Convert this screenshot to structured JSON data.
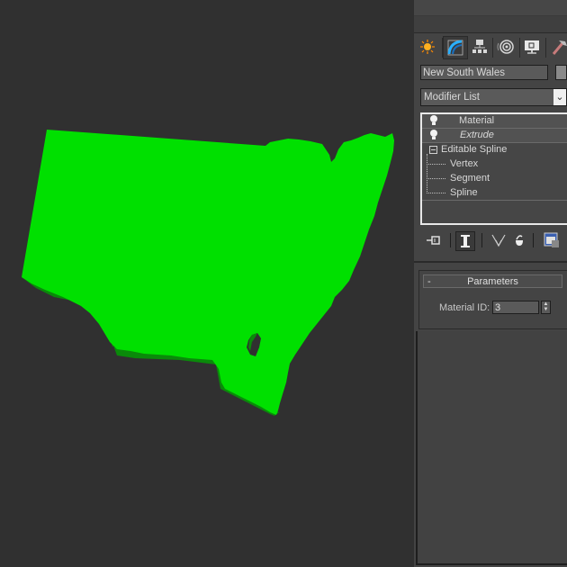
{
  "viewport": {
    "object_name": "New South Wales",
    "object_color": "#00e000",
    "background_color": "#303030"
  },
  "command_panel": {
    "tabs": [
      {
        "name": "create",
        "icon": "create-icon"
      },
      {
        "name": "modify",
        "icon": "modify-icon",
        "active": true
      },
      {
        "name": "hierarchy",
        "icon": "hierarchy-icon"
      },
      {
        "name": "motion",
        "icon": "motion-icon"
      },
      {
        "name": "display",
        "icon": "display-icon"
      },
      {
        "name": "utilities",
        "icon": "utilities-icon"
      }
    ],
    "object_name_value": "New South Wales",
    "modifier_list_label": "Modifier List",
    "modifier_list_arrow": "⌄",
    "stack": {
      "items": [
        {
          "label": "Material",
          "type": "modifier"
        },
        {
          "label": "Extrude",
          "type": "modifier",
          "italic": true
        },
        {
          "label": "Editable Spline",
          "type": "base"
        },
        {
          "label": "Vertex",
          "type": "sub"
        },
        {
          "label": "Segment",
          "type": "sub"
        },
        {
          "label": "Spline",
          "type": "sub"
        }
      ]
    },
    "stack_tools": [
      {
        "name": "pin-stack",
        "icon": "pin-icon"
      },
      {
        "name": "show-end-result",
        "icon": "end-result-icon",
        "active": true
      },
      {
        "name": "make-unique",
        "icon": "make-unique-icon"
      },
      {
        "name": "remove-modifier",
        "icon": "remove-modifier-icon"
      },
      {
        "name": "configure-modifier-sets",
        "icon": "configure-icon"
      }
    ],
    "parameters": {
      "title": "Parameters",
      "collapse_symbol": "-",
      "material_id_label": "Material ID:",
      "material_id_value": "3"
    }
  }
}
